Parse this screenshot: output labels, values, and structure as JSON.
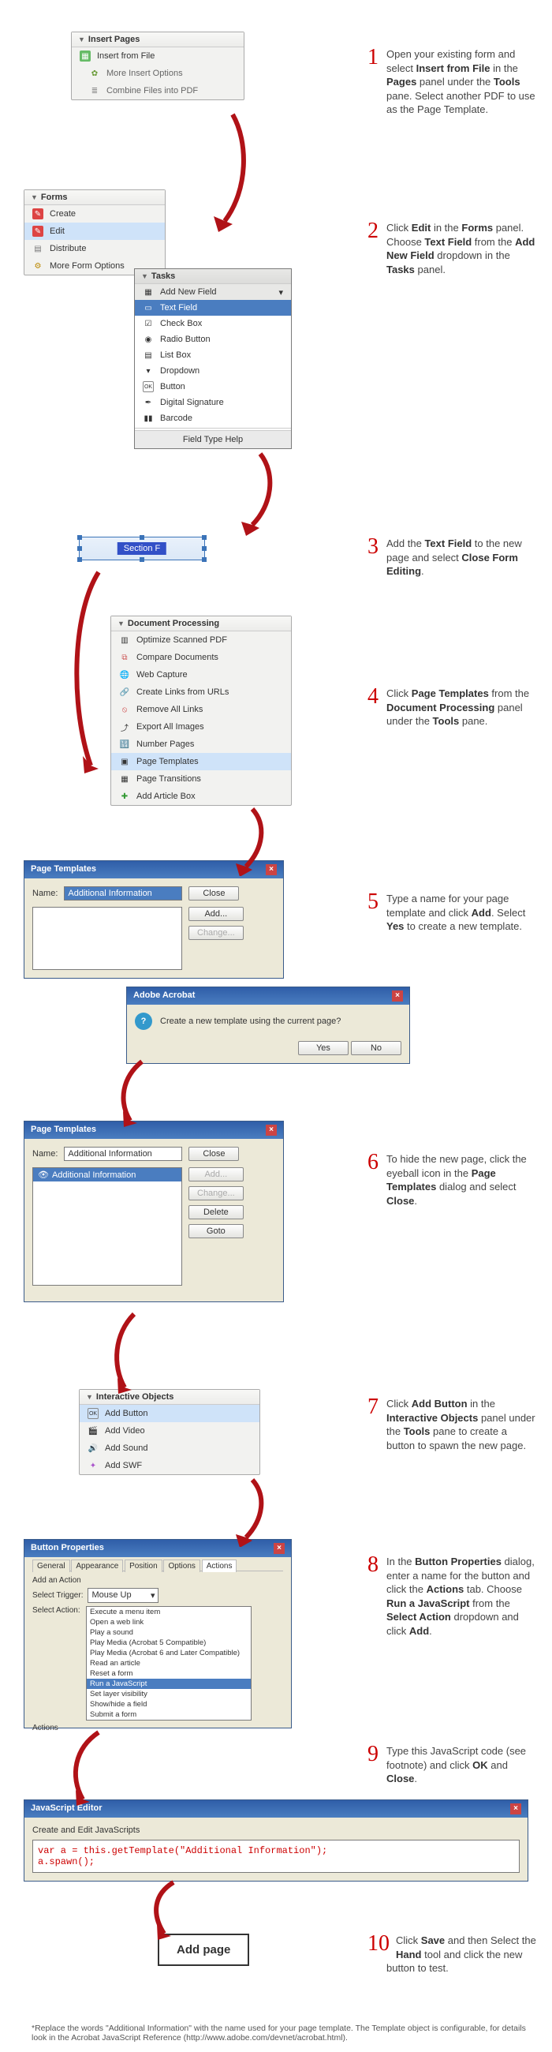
{
  "instructions": {
    "s1": {
      "n": "1",
      "t1": "Open your existing form and select ",
      "b1": "Insert from File",
      "t2": " in the ",
      "b2": "Pages",
      "t3": " panel under the ",
      "b3": "Tools",
      "t4": " pane. Select another PDF to use as the Page Template."
    },
    "s2": {
      "n": "2",
      "t1": "Click ",
      "b1": "Edit",
      "t2": " in the ",
      "b2": "Forms",
      "t3": " panel. Choose ",
      "b3": "Text Field",
      "t4": " from the ",
      "b4": "Add New Field",
      "t5": " dropdown in the ",
      "b5": "Tasks",
      "t6": " panel."
    },
    "s3": {
      "n": "3",
      "t1": "Add the ",
      "b1": "Text Field",
      "t2": " to the new page and select ",
      "b2": "Close Form Editing",
      "t3": "."
    },
    "s4": {
      "n": "4",
      "t1": "Click ",
      "b1": "Page Templates",
      "t2": " from the ",
      "b2": "Document Processing",
      "t3": " panel under the ",
      "b3": "Tools",
      "t4": " pane."
    },
    "s5": {
      "n": "5",
      "t1": "Type a name for your page template and click ",
      "b1": "Add",
      "t2": ". Select ",
      "b2": "Yes",
      "t3": " to create a new template."
    },
    "s6": {
      "n": "6",
      "t1": "To hide the new page, click the eyeball icon in the ",
      "b1": "Page Templates",
      "t2": " dialog and select ",
      "b2": "Close",
      "t3": "."
    },
    "s7": {
      "n": "7",
      "t1": "Click ",
      "b1": "Add Button",
      "t2": " in the ",
      "b2": "Interactive Objects",
      "t3": " panel under the ",
      "b3": "Tools",
      "t4": " pane to create a button to spawn the new page."
    },
    "s8": {
      "n": "8",
      "t1": "In the ",
      "b1": "Button Properties",
      "t2": " dialog, enter a name for the button and click the ",
      "b2": "Actions",
      "t3": " tab. Choose ",
      "b3": "Run a JavaScript",
      "t4": " from the ",
      "b4": "Select Action",
      "t5": " dropdown and click ",
      "b5": "Add",
      "t6": "."
    },
    "s9": {
      "n": "9",
      "t1": "Type this JavaScript code (see footnote) and click ",
      "b1": "OK",
      "t2": " and ",
      "b2": "Close",
      "t3": "."
    },
    "s10": {
      "n": "10",
      "t1": "Click ",
      "b1": "Save",
      "t2": " and then Select the ",
      "b2": "Hand",
      "t3": " tool and click the new button to test."
    }
  },
  "insert_pages": {
    "title": "Insert Pages",
    "items": [
      "Insert from File",
      "More Insert Options",
      "Combine Files into PDF"
    ]
  },
  "forms_panel": {
    "title": "Forms",
    "items": [
      "Create",
      "Edit",
      "Distribute",
      "More Form Options"
    ]
  },
  "tasks_menu": {
    "title": "Tasks",
    "header": "Add New Field",
    "items": [
      "Text Field",
      "Check Box",
      "Radio Button",
      "List Box",
      "Dropdown",
      "Button",
      "Digital Signature",
      "Barcode"
    ],
    "help": "Field Type Help"
  },
  "tf_label": "Section F",
  "doc_processing": {
    "title": "Document Processing",
    "items": [
      "Optimize Scanned PDF",
      "Compare Documents",
      "Web Capture",
      "Create Links from URLs",
      "Remove All Links",
      "Export All Images",
      "Number Pages",
      "Page Templates",
      "Page Transitions",
      "Add Article Box"
    ]
  },
  "pt_dlg1": {
    "title": "Page Templates",
    "name_lbl": "Name:",
    "name_val": "Additional Information",
    "btns": [
      "Close",
      "Add...",
      "Change..."
    ]
  },
  "confirm_dlg": {
    "title": "Adobe Acrobat",
    "msg": "Create a new template using the current page?",
    "yes": "Yes",
    "no": "No"
  },
  "pt_dlg2": {
    "title": "Page Templates",
    "name_lbl": "Name:",
    "name_val": "Additional Information",
    "list_item": "Additional Information",
    "btns": [
      "Close",
      "Add...",
      "Change...",
      "Delete",
      "Goto"
    ]
  },
  "interactive": {
    "title": "Interactive Objects",
    "items": [
      "Add Button",
      "Add Video",
      "Add Sound",
      "Add SWF"
    ]
  },
  "btn_props": {
    "title": "Button Properties",
    "tabs": [
      "General",
      "Appearance",
      "Position",
      "Options",
      "Actions"
    ],
    "add_action": "Add an Action",
    "trigger_lbl": "Select Trigger:",
    "trigger_val": "Mouse Up",
    "action_lbl": "Select Action:",
    "actions_word": "Actions",
    "list": [
      "Execute a menu item",
      "Open a web link",
      "Play a sound",
      "Play Media (Acrobat 5 Compatible)",
      "Play Media (Acrobat 6 and Later Compatible)",
      "Read an article",
      "Reset a form",
      "Run a JavaScript",
      "Set layer visibility",
      "Show/hide a field",
      "Submit a form"
    ]
  },
  "js_editor": {
    "title": "JavaScript Editor",
    "sub": "Create and Edit JavaScripts",
    "code": "var a = this.getTemplate(\"Additional Information\");\na.spawn();"
  },
  "add_page_btn": "Add page",
  "footnote": "*Replace the words \"Additional Information\" with the name used for your page template. The Template object is configurable, for details look in the Acrobat JavaScript Reference (http://www.adobe.com/devnet/acrobat.html)."
}
